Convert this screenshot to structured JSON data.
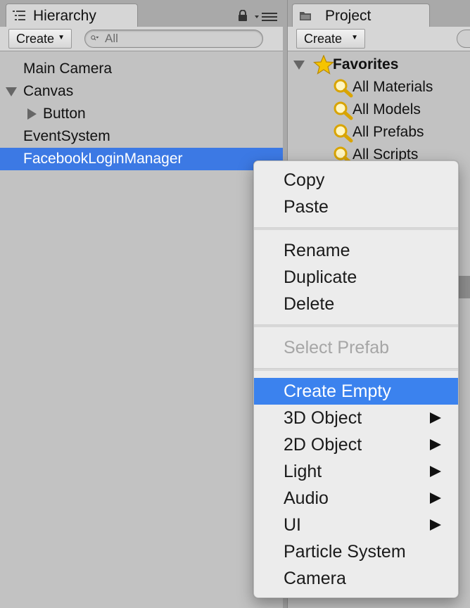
{
  "hierarchy": {
    "tab_label": "Hierarchy",
    "create_label": "Create",
    "search_placeholder": "All",
    "items": [
      {
        "label": "Main Camera"
      },
      {
        "label": "Canvas"
      },
      {
        "label": "Button"
      },
      {
        "label": "EventSystem"
      },
      {
        "label": "FacebookLoginManager"
      }
    ]
  },
  "project": {
    "tab_label": "Project",
    "create_label": "Create",
    "favorites": {
      "label": "Favorites",
      "items": [
        {
          "label": "All Materials"
        },
        {
          "label": "All Models"
        },
        {
          "label": "All Prefabs"
        },
        {
          "label": "All Scripts"
        }
      ]
    }
  },
  "context_menu": {
    "items": [
      {
        "label": "Copy"
      },
      {
        "label": "Paste"
      },
      {
        "label": "Rename"
      },
      {
        "label": "Duplicate"
      },
      {
        "label": "Delete"
      },
      {
        "label": "Select Prefab"
      },
      {
        "label": "Create Empty"
      },
      {
        "label": "3D Object"
      },
      {
        "label": "2D Object"
      },
      {
        "label": "Light"
      },
      {
        "label": "Audio"
      },
      {
        "label": "UI"
      },
      {
        "label": "Particle System"
      },
      {
        "label": "Camera"
      }
    ]
  },
  "colors": {
    "selection": "#3c79e4",
    "menu_highlight": "#3b82ee",
    "panel_bg": "#c2c2c2",
    "favorites_star": "#f5c400"
  }
}
